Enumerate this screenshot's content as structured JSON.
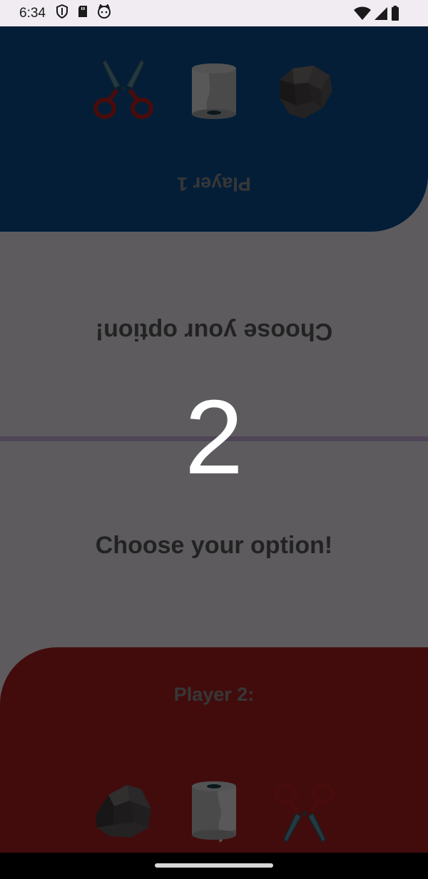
{
  "status_bar": {
    "time": "6:34",
    "left_icons": [
      "shield-icon",
      "sd-card-icon",
      "cat-face-icon"
    ],
    "right_icons": [
      "wifi-icon",
      "signal-icon",
      "battery-icon"
    ]
  },
  "player1": {
    "label": "Player 1",
    "color": "#0c4c8c",
    "options": [
      "scissors",
      "paper",
      "rock"
    ]
  },
  "player2": {
    "label": "Player 2:",
    "color": "#a61e1e",
    "options": [
      "rock",
      "paper",
      "scissors"
    ]
  },
  "prompt": {
    "top_text": "Choose your option!",
    "bottom_text": "Choose your option!"
  },
  "countdown": {
    "value": "2"
  },
  "colors": {
    "background": "#e8e4ec",
    "divider": "#c7b0d6",
    "overlay": "rgba(0,0,0,0.60)"
  }
}
